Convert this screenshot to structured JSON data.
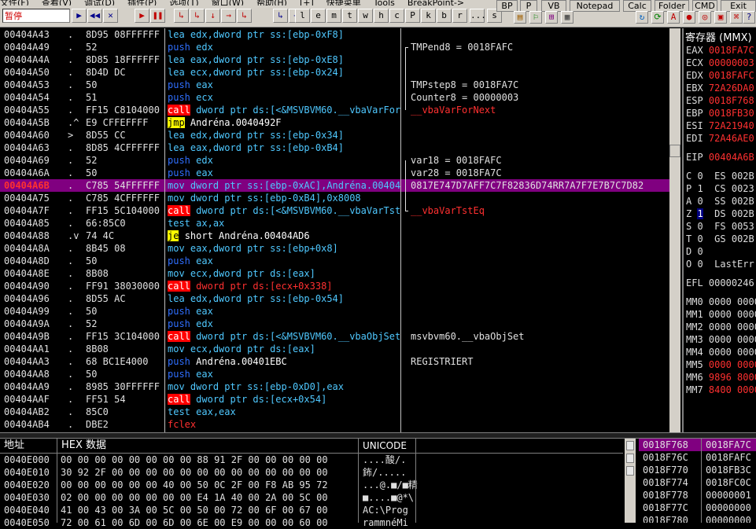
{
  "menubar": {
    "items": [
      "文件(F)",
      "查看(V)",
      "调试(D)",
      "插件(P)",
      "选项(T)",
      "窗口(W)",
      "帮助(H)",
      "[+]",
      "快捷菜单",
      "Tools",
      "BreakPoint->"
    ]
  },
  "toolbar": {
    "status_label": "暂停",
    "buttons": [
      "▶",
      "◀◀",
      "✕",
      "▶",
      "❚❚",
      "↳",
      "↳",
      "↓",
      "→",
      "↳",
      "↳",
      "⇥"
    ],
    "letter_buttons": [
      "l",
      "e",
      "m",
      "t",
      "w",
      "h",
      "c",
      "P",
      "k",
      "b",
      "r",
      "...",
      "s"
    ],
    "text_buttons": [
      "BP",
      "P",
      "VB",
      "Notepad",
      "Calc",
      "Folder",
      "CMD",
      "Exit"
    ]
  },
  "disasm": {
    "rows": [
      {
        "addr": "00404A43",
        "jmp": ".",
        "hex": "8D95 08FFFFFF",
        "op": "lea",
        "opc": "lea",
        "args": "edx,dword ptr ss:[ebp-0xF8]",
        "cmt": ""
      },
      {
        "addr": "00404A49",
        "jmp": ".",
        "hex": "52",
        "op": "push",
        "opc": "push",
        "args": "edx",
        "cmt": "TMPend8 = 0018FAFC"
      },
      {
        "addr": "00404A4A",
        "jmp": ".",
        "hex": "8D85 18FFFFFF",
        "op": "lea",
        "opc": "lea",
        "args": "eax,dword ptr ss:[ebp-0xE8]",
        "cmt": ""
      },
      {
        "addr": "00404A50",
        "jmp": ".",
        "hex": "8D4D DC",
        "op": "lea",
        "opc": "lea",
        "args": "ecx,dword ptr ss:[ebp-0x24]",
        "cmt": ""
      },
      {
        "addr": "00404A53",
        "jmp": ".",
        "hex": "50",
        "op": "push",
        "opc": "push",
        "args": "eax",
        "cmt": "TMPstep8 = 0018FA7C"
      },
      {
        "addr": "00404A54",
        "jmp": ".",
        "hex": "51",
        "op": "push",
        "opc": "push",
        "args": "ecx",
        "cmt": "Counter8 = 00000003"
      },
      {
        "addr": "00404A55",
        "jmp": ".",
        "hex": "FF15 C8104000",
        "op": "call",
        "opc": "call",
        "args": "dword ptr ds:[<&MSVBVM60.__vbaVarForNext>]",
        "cmt": "__vbaVarForNext",
        "cmtc": "red"
      },
      {
        "addr": "00404A5B",
        "jmp": ".^",
        "hex": "E9 CFFEFFFF",
        "op": "jmp",
        "opc": "jmp",
        "args": "Andréna.0040492F",
        "argc": "white",
        "cmt": ""
      },
      {
        "addr": "00404A60",
        "jmp": ">",
        "hex": "8D55 CC",
        "op": "lea",
        "opc": "lea",
        "args": "edx,dword ptr ss:[ebp-0x34]",
        "cmt": ""
      },
      {
        "addr": "00404A63",
        "jmp": ".",
        "hex": "8D85 4CFFFFFF",
        "op": "lea",
        "opc": "lea",
        "args": "eax,dword ptr ss:[ebp-0xB4]",
        "cmt": ""
      },
      {
        "addr": "00404A69",
        "jmp": ".",
        "hex": "52",
        "op": "push",
        "opc": "push",
        "args": "edx",
        "cmt": "var18 = 0018FAFC"
      },
      {
        "addr": "00404A6A",
        "jmp": ".",
        "hex": "50",
        "op": "push",
        "opc": "push",
        "args": "eax",
        "cmt": "var28 = 0018FA7C"
      },
      {
        "addr": "00404A6B",
        "jmp": ".",
        "hex": "C785 54FFFFFF",
        "op": "mov",
        "opc": "mov",
        "args": "dword ptr ss:[ebp-0xAC],Andréna.00404A3C",
        "cmt": "0817E747D7AFF7C7F82836D74RR7A7F7E7B7C7D82",
        "sel": true
      },
      {
        "addr": "00404A75",
        "jmp": ".",
        "hex": "C785 4CFFFFFF",
        "op": "mov",
        "opc": "mov",
        "args": "dword ptr ss:[ebp-0xB4],0x8008",
        "cmt": ""
      },
      {
        "addr": "00404A7F",
        "jmp": ".",
        "hex": "FF15 5C104000",
        "op": "call",
        "opc": "call",
        "args": "dword ptr ds:[<&MSVBVM60.__vbaVarTstEq>]",
        "cmt": "__vbaVarTstEq",
        "cmtc": "red"
      },
      {
        "addr": "00404A85",
        "jmp": ".",
        "hex": "66:85C0",
        "op": "test",
        "opc": "mov",
        "args": "ax,ax",
        "cmt": ""
      },
      {
        "addr": "00404A88",
        "jmp": ".v",
        "hex": "74 4C",
        "op": "je",
        "opc": "je",
        "args": "short Andréna.00404AD6",
        "argc": "white",
        "cmt": ""
      },
      {
        "addr": "00404A8A",
        "jmp": ".",
        "hex": "8B45 08",
        "op": "mov",
        "opc": "mov",
        "args": "eax,dword ptr ss:[ebp+0x8]",
        "cmt": ""
      },
      {
        "addr": "00404A8D",
        "jmp": ".",
        "hex": "50",
        "op": "push",
        "opc": "push",
        "args": "eax",
        "cmt": ""
      },
      {
        "addr": "00404A8E",
        "jmp": ".",
        "hex": "8B08",
        "op": "mov",
        "opc": "mov",
        "args": "ecx,dword ptr ds:[eax]",
        "cmt": ""
      },
      {
        "addr": "00404A90",
        "jmp": ".",
        "hex": "FF91 38030000",
        "op": "call",
        "opc": "call",
        "args": "dword ptr ds:[ecx+0x338]",
        "argc": "call",
        "cmt": ""
      },
      {
        "addr": "00404A96",
        "jmp": ".",
        "hex": "8D55 AC",
        "op": "lea",
        "opc": "lea",
        "args": "edx,dword ptr ss:[ebp-0x54]",
        "cmt": ""
      },
      {
        "addr": "00404A99",
        "jmp": ".",
        "hex": "50",
        "op": "push",
        "opc": "push",
        "args": "eax",
        "cmt": ""
      },
      {
        "addr": "00404A9A",
        "jmp": ".",
        "hex": "52",
        "op": "push",
        "opc": "push",
        "args": "edx",
        "cmt": ""
      },
      {
        "addr": "00404A9B",
        "jmp": ".",
        "hex": "FF15 3C104000",
        "op": "call",
        "opc": "call",
        "args": "dword ptr ds:[<&MSVBVM60.__vbaObjSet>]",
        "cmt": "msvbvm60.__vbaObjSet"
      },
      {
        "addr": "00404AA1",
        "jmp": ".",
        "hex": "8B08",
        "op": "mov",
        "opc": "mov",
        "args": "ecx,dword ptr ds:[eax]",
        "cmt": ""
      },
      {
        "addr": "00404AA3",
        "jmp": ".",
        "hex": "68 BC1E4000",
        "op": "push",
        "opc": "push",
        "args": "Andréna.00401EBC",
        "argc": "white",
        "cmt": "REGISTRIERT"
      },
      {
        "addr": "00404AA8",
        "jmp": ".",
        "hex": "50",
        "op": "push",
        "opc": "push",
        "args": "eax",
        "cmt": ""
      },
      {
        "addr": "00404AA9",
        "jmp": ".",
        "hex": "8985 30FFFFFF",
        "op": "mov",
        "opc": "mov",
        "args": "dword ptr ss:[ebp-0xD0],eax",
        "cmt": ""
      },
      {
        "addr": "00404AAF",
        "jmp": ".",
        "hex": "FF51 54",
        "op": "call",
        "opc": "call",
        "args": "dword ptr ds:[ecx+0x54]",
        "cmt": ""
      },
      {
        "addr": "00404AB2",
        "jmp": ".",
        "hex": "85C0",
        "op": "test",
        "opc": "mov",
        "args": "eax,eax",
        "cmt": ""
      },
      {
        "addr": "00404AB4",
        "jmp": ".",
        "hex": "DBE2",
        "op": "fclex",
        "opc": "red",
        "args": "",
        "cmt": ""
      }
    ]
  },
  "registers": {
    "title": "寄存器 (MMX)",
    "gp": [
      {
        "name": "EAX",
        "value": "0018FA7C"
      },
      {
        "name": "ECX",
        "value": "00000003"
      },
      {
        "name": "EDX",
        "value": "0018FAFC"
      },
      {
        "name": "EBX",
        "value": "72A26DA0"
      },
      {
        "name": "ESP",
        "value": "0018F768"
      },
      {
        "name": "EBP",
        "value": "0018FB30"
      },
      {
        "name": "ESI",
        "value": "72A21940"
      },
      {
        "name": "EDI",
        "value": "72A46AE0"
      }
    ],
    "eip": {
      "name": "EIP",
      "value": "00404A6B"
    },
    "flags": [
      {
        "f": "C",
        "v": "0",
        "seg": "ES",
        "sv": "002B"
      },
      {
        "f": "P",
        "v": "1",
        "seg": "CS",
        "sv": "0023"
      },
      {
        "f": "A",
        "v": "0",
        "seg": "SS",
        "sv": "002B"
      },
      {
        "f": "Z",
        "v": "1",
        "seg": "DS",
        "sv": "002B",
        "hl": true
      },
      {
        "f": "S",
        "v": "0",
        "seg": "FS",
        "sv": "0053"
      },
      {
        "f": "T",
        "v": "0",
        "seg": "GS",
        "sv": "002B"
      },
      {
        "f": "D",
        "v": "0",
        "seg": "",
        "sv": ""
      },
      {
        "f": "O",
        "v": "0",
        "seg": "LastErr",
        "sv": ""
      }
    ],
    "efl": {
      "name": "EFL",
      "value": "00000246"
    },
    "mmx": [
      {
        "name": "MM0",
        "value": "0000 0000",
        "red": false
      },
      {
        "name": "MM1",
        "value": "0000 0000",
        "red": false
      },
      {
        "name": "MM2",
        "value": "0000 0000",
        "red": false
      },
      {
        "name": "MM3",
        "value": "0000 0000",
        "red": false
      },
      {
        "name": "MM4",
        "value": "0000 0000",
        "red": false
      },
      {
        "name": "MM5",
        "value": "0000 0000",
        "red": true
      },
      {
        "name": "MM6",
        "value": "9896 8000",
        "red": true
      },
      {
        "name": "MM7",
        "value": "8400 0000",
        "red": true
      }
    ]
  },
  "hexdump": {
    "headers": {
      "addr": "地址",
      "hex": "HEX 数据",
      "text": "UNICODE"
    },
    "rows": [
      {
        "addr": "0040E000",
        "bytes": "00 00 00 00 00 00 00 00 88 91 2F 00 00 00 00 00",
        "text": "....酸/."
      },
      {
        "addr": "0040E010",
        "bytes": "30 92 2F 00 00 00 00 00 00 00 00 00 00 00 00 00",
        "text": "鈽/....."
      },
      {
        "addr": "0040E020",
        "bytes": "00 00 00 00 00 00 40 00 50 0C 2F 00 F8 AB 95 72",
        "text": "...@.■/■精"
      },
      {
        "addr": "0040E030",
        "bytes": "02 00 00 00 00 00 00 00 E4 1A 40 00 2A 00 5C 00",
        "text": "■....■@*\\"
      },
      {
        "addr": "0040E040",
        "bytes": "41 00 43 00 3A 00 5C 00 50 00 72 00 6F 00 67 00",
        "text": "AC:\\Prog"
      },
      {
        "addr": "0040E050",
        "bytes": "72 00 61 00 6D 00 6D 00 6E 00 E9 00 00 00 60 00",
        "text": "rammnéMi"
      }
    ]
  },
  "stack": {
    "rows": [
      {
        "addr": "0018F768",
        "value": "0018FA7C",
        "sel": true
      },
      {
        "addr": "0018F76C",
        "value": "0018FAFC"
      },
      {
        "addr": "0018F770",
        "value": "0018FB3C"
      },
      {
        "addr": "0018F774",
        "value": "0018FC0C"
      },
      {
        "addr": "0018F778",
        "value": "00000001"
      },
      {
        "addr": "0018F77C",
        "value": "00000000"
      },
      {
        "addr": "0018F780",
        "value": "00000000"
      }
    ]
  }
}
